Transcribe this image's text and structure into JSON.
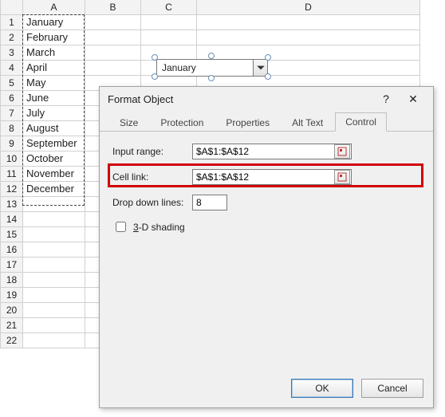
{
  "columns": [
    "A",
    "B",
    "C",
    "D"
  ],
  "row_count": 22,
  "months": [
    "January",
    "February",
    "March",
    "April",
    "May",
    "June",
    "July",
    "August",
    "September",
    "October",
    "November",
    "December"
  ],
  "combo": {
    "value": "January"
  },
  "dialog": {
    "title": "Format Object",
    "help": "?",
    "close": "✕",
    "tabs": [
      "Size",
      "Protection",
      "Properties",
      "Alt Text",
      "Control"
    ],
    "active_tab": 4,
    "control": {
      "input_range_label": "Input range:",
      "input_range_value": "$A$1:$A$12",
      "cell_link_label": "Cell link:",
      "cell_link_value": "$A$1:$A$12",
      "dropdown_lines_label": "Drop down lines:",
      "dropdown_lines_value": "8",
      "shading_label": "3-D shading"
    },
    "buttons": {
      "ok": "OK",
      "cancel": "Cancel"
    }
  }
}
